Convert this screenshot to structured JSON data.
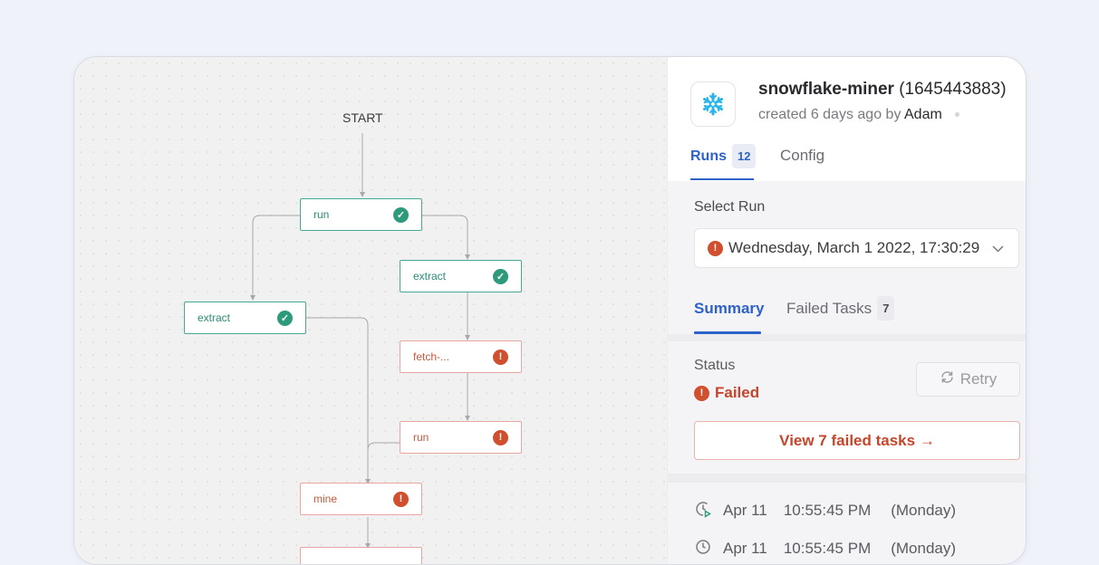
{
  "graph": {
    "start_label": "START",
    "nodes": [
      {
        "label": "run",
        "status": "success"
      },
      {
        "label": "extract",
        "status": "success"
      },
      {
        "label": "extract",
        "status": "success"
      },
      {
        "label": "fetch-...",
        "status": "failed"
      },
      {
        "label": "run",
        "status": "failed"
      },
      {
        "label": "mine",
        "status": "failed"
      }
    ]
  },
  "panel": {
    "title_name": "snowflake-miner",
    "title_id": "(1645443883)",
    "created_text": "created 6 days ago by",
    "created_by": "Adam",
    "tabs": [
      {
        "label": "Runs",
        "count": "12"
      },
      {
        "label": "Config"
      }
    ],
    "select_run_label": "Select Run",
    "selected_run": "Wednesday, March 1 2022, 17:30:29",
    "subtabs": [
      {
        "label": "Summary"
      },
      {
        "label": "Failed Tasks",
        "count": "7"
      }
    ],
    "status_label": "Status",
    "status_value": "Failed",
    "retry_label": "Retry",
    "view_failed_label": "View 7 failed tasks →",
    "events": [
      {
        "date": "Apr 11",
        "time": "10:55:45 PM",
        "day": "(Monday)"
      },
      {
        "date": "Apr 11",
        "time": "10:55:45 PM",
        "day": "(Monday)"
      }
    ]
  },
  "colors": {
    "accent": "#2e62c8",
    "success": "#2c9a7b",
    "danger": "#cf4f2e"
  },
  "icons": {
    "success": "check-circle-icon",
    "failed": "exclamation-circle-icon",
    "logo": "snowflake-icon",
    "retry": "refresh-icon",
    "dropdown": "chevron-down-icon",
    "event": "clock-play-icon"
  }
}
